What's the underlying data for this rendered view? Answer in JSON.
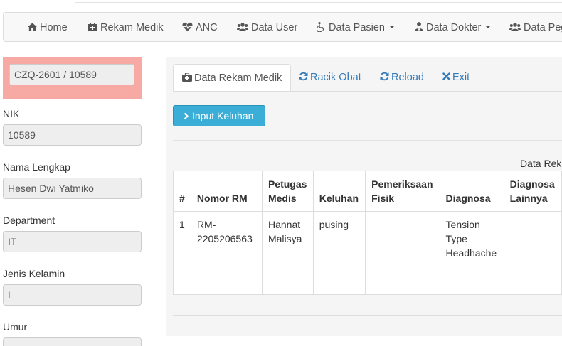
{
  "nav": {
    "items": [
      {
        "label": "Home",
        "icon": "home-icon"
      },
      {
        "label": "Rekam Medik",
        "icon": "medkit-icon"
      },
      {
        "label": "ANC",
        "icon": "heartbeat-icon"
      },
      {
        "label": "Data User",
        "icon": "users-icon"
      },
      {
        "label": "Data Pasien",
        "icon": "wheelchair-icon",
        "dropdown": true
      },
      {
        "label": "Data Dokter",
        "icon": "user-md-icon",
        "dropdown": true
      },
      {
        "label": "Data Peg",
        "icon": "users-icon"
      }
    ]
  },
  "patient": {
    "id_code": "CZQ-2601 / 10589",
    "fields": [
      {
        "label": "NIK",
        "value": "10589"
      },
      {
        "label": "Nama Lengkap",
        "value": "Hesen Dwi Yatmiko"
      },
      {
        "label": "Department",
        "value": "IT"
      },
      {
        "label": "Jenis Kelamin",
        "value": "L"
      },
      {
        "label": "Umur",
        "value": ""
      }
    ]
  },
  "tabs": [
    {
      "label": "Data Rekam Medik",
      "icon": "medkit-icon",
      "active": true
    },
    {
      "label": "Racik Obat",
      "icon": "refresh-icon"
    },
    {
      "label": "Reload",
      "icon": "refresh-icon"
    },
    {
      "label": "Exit",
      "icon": "close-icon"
    }
  ],
  "actions": {
    "input_keluhan": "Input Keluhan"
  },
  "table": {
    "caption": "Data Rek",
    "headers": [
      "#",
      "Nomor RM",
      "Petugas Medis",
      "Keluhan",
      "Pemeriksaan Fisik",
      "Diagnosa",
      "Diagnosa Lainnya"
    ],
    "rows": [
      [
        "1",
        "RM-2205206563",
        "Hannat Malisya",
        "pusing",
        "",
        "Tension Type Headhache",
        ""
      ]
    ]
  },
  "colors": {
    "accent": "#3aaed7",
    "link": "#337ab7",
    "id_box": "#f7a9a4"
  }
}
